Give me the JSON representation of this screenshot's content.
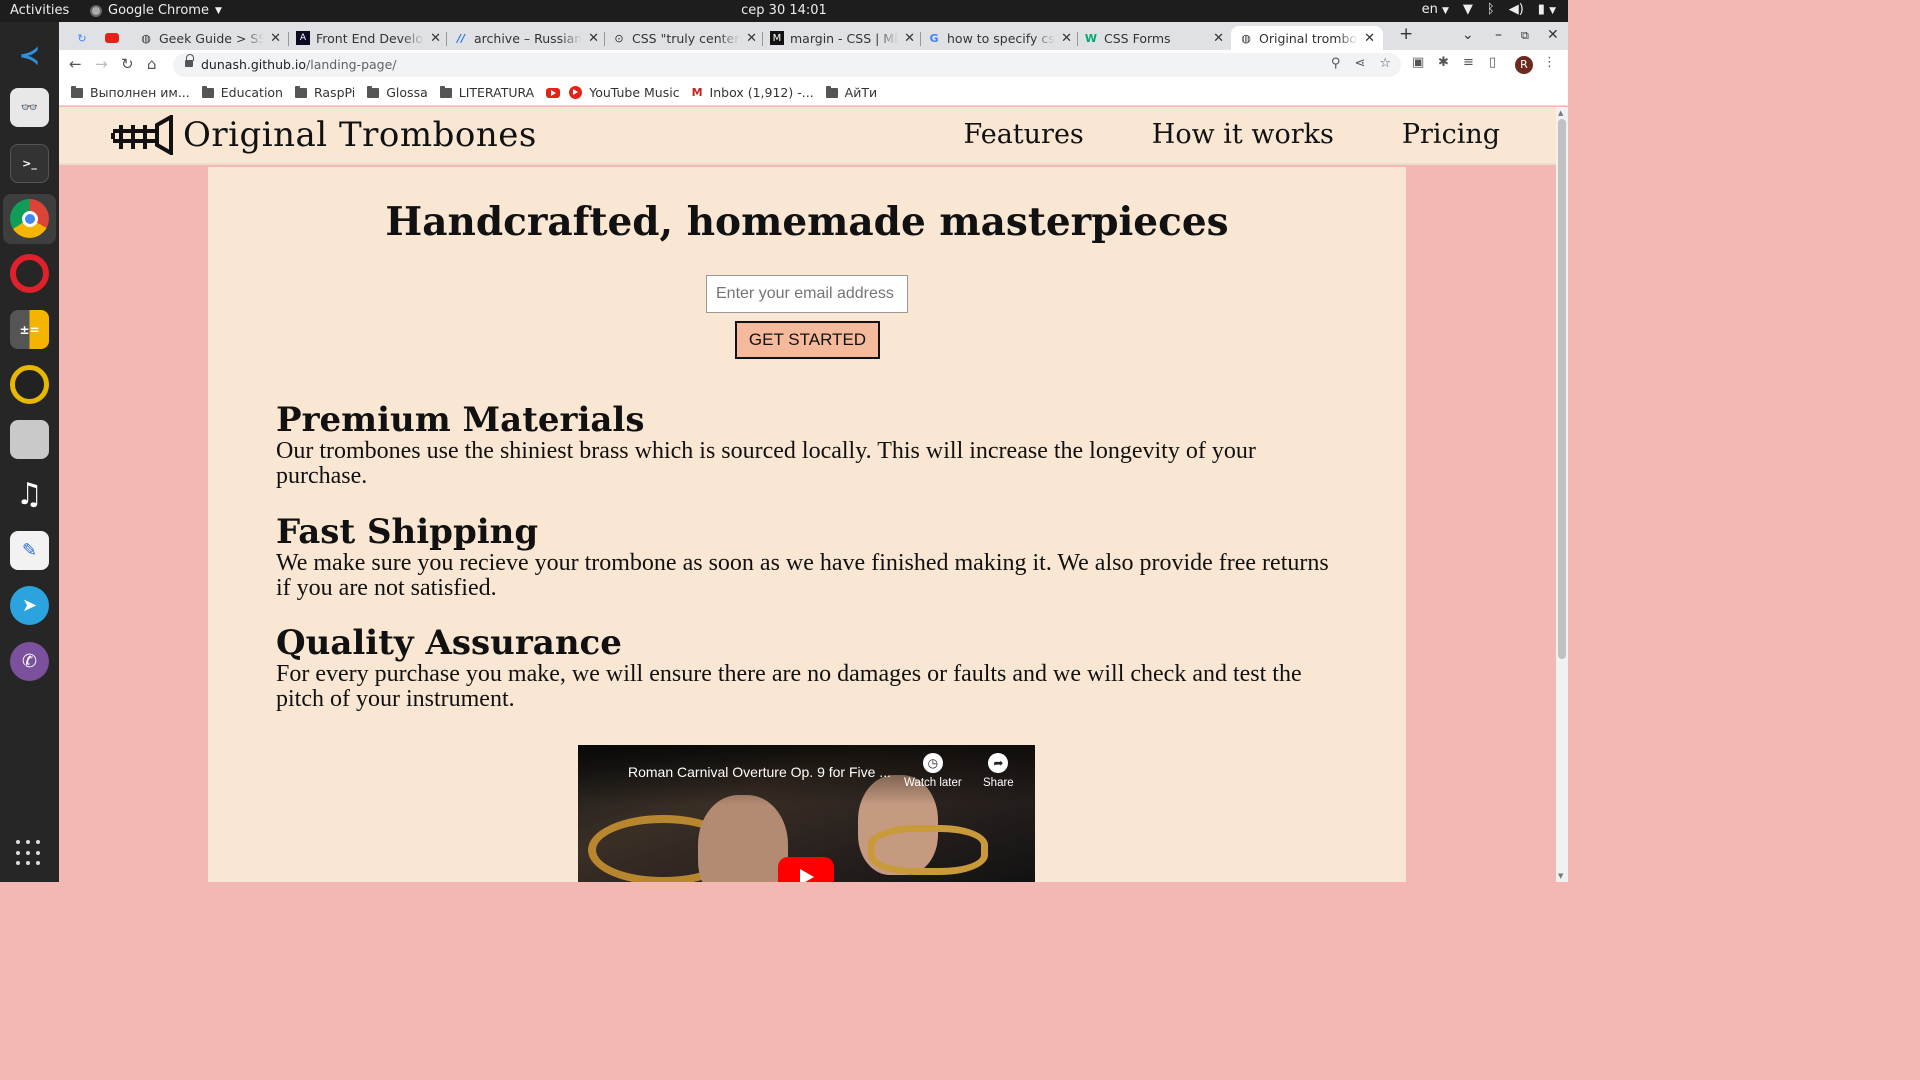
{
  "os": {
    "activities": "Activities",
    "app_name": "Google Chrome",
    "clock": "сер 30  14:01",
    "lang": "en"
  },
  "browser": {
    "tabs": [
      {
        "title": "",
        "icon": "google-refresh-icon"
      },
      {
        "title": "",
        "icon": "youtube-icon"
      },
      {
        "title": "Geek Guide > SSH: ",
        "icon": "globe-icon"
      },
      {
        "title": "Front End Develop",
        "icon": "freecodecamp-icon"
      },
      {
        "title": "archive – Russian t",
        "icon": "wordpress-icon"
      },
      {
        "title": "CSS \"truly center\" a",
        "icon": "codepen-icon"
      },
      {
        "title": "margin - CSS | MDN",
        "icon": "mdn-icon"
      },
      {
        "title": "how to specify css",
        "icon": "google-icon"
      },
      {
        "title": "CSS Forms",
        "icon": "w3schools-icon"
      },
      {
        "title": "Original trombone",
        "icon": "globe-icon",
        "active": true
      }
    ],
    "url_host": "dunash.github.io",
    "url_path": "/landing-page/",
    "avatar_letter": "R",
    "bookmarks": [
      {
        "label": "Выполнен им...",
        "icon": "folder-icon"
      },
      {
        "label": "Education",
        "icon": "folder-icon"
      },
      {
        "label": "RaspPi",
        "icon": "folder-icon"
      },
      {
        "label": "Glossa",
        "icon": "folder-icon"
      },
      {
        "label": "LITERATURA",
        "icon": "folder-icon"
      },
      {
        "label": "",
        "icon": "youtube-icon"
      },
      {
        "label": "YouTube Music",
        "icon": "youtube-music-icon"
      },
      {
        "label": "Inbox (1,912) -...",
        "icon": "gmail-icon"
      },
      {
        "label": "АйТи",
        "icon": "folder-icon"
      }
    ]
  },
  "site": {
    "brand": "Original Trombones",
    "nav": [
      "Features",
      "How it works",
      "Pricing"
    ],
    "hero_title": "Handcrafted, homemade masterpieces",
    "email_placeholder": "Enter your email address",
    "cta": "GET STARTED",
    "features": [
      {
        "title": "Premium Materials",
        "text": "Our trombones use the shiniest brass which is sourced locally. This will increase the longevity of your purchase."
      },
      {
        "title": "Fast Shipping",
        "text": "We make sure you recieve your trombone as soon as we have finished making it. We also provide free returns if you are not satisfied."
      },
      {
        "title": "Quality Assurance",
        "text": "For every purchase you make, we will ensure there are no damages or faults and we will check and test the pitch of your instrument."
      }
    ],
    "video": {
      "title": "Roman Carnival Overture Op. 9 for Five ...",
      "watch_later": "Watch later",
      "share": "Share"
    }
  },
  "colors": {
    "page_bg": "#f4b8b4",
    "content_bg": "#f9e7d3",
    "cta_bg": "#f5b99b"
  }
}
